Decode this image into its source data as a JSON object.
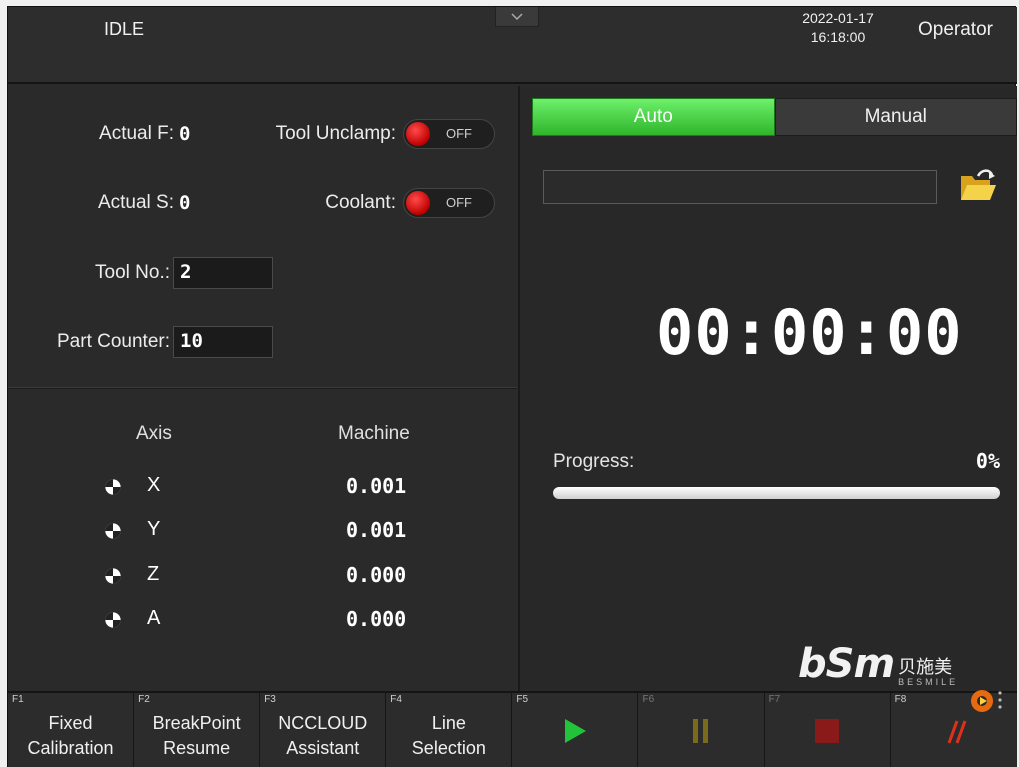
{
  "header": {
    "status": "IDLE",
    "date": "2022-01-17",
    "time": "16:18:00",
    "user": "Operator",
    "dropdown_icon": "chevron-down-icon"
  },
  "left": {
    "actual_f_label": "Actual F:",
    "actual_f_value": "0",
    "actual_s_label": "Actual S:",
    "actual_s_value": "0",
    "tool_unclamp_label": "Tool Unclamp:",
    "tool_unclamp_state": "OFF",
    "coolant_label": "Coolant:",
    "coolant_state": "OFF",
    "tool_no_label": "Tool No.:",
    "tool_no_value": "2",
    "part_counter_label": "Part Counter:",
    "part_counter_value": "10",
    "axis_header": "Axis",
    "machine_header": "Machine",
    "axes": [
      {
        "name": "X",
        "value": "0.001"
      },
      {
        "name": "Y",
        "value": "0.001"
      },
      {
        "name": "Z",
        "value": "0.000"
      },
      {
        "name": "A",
        "value": "0.000"
      }
    ]
  },
  "right": {
    "mode_auto": "Auto",
    "mode_manual": "Manual",
    "active_mode": "Auto",
    "file_path": "",
    "folder_icon": "folder-open-icon",
    "timer": "00:00:00",
    "progress_label": "Progress:",
    "progress_text": "0%",
    "progress_percent": 0,
    "logo_main": "bSm",
    "logo_cn": "贝施美",
    "logo_en": "BESMILE"
  },
  "fkeys": [
    {
      "key": "F1",
      "label1": "Fixed",
      "label2": "Calibration"
    },
    {
      "key": "F2",
      "label1": "BreakPoint",
      "label2": "Resume"
    },
    {
      "key": "F3",
      "label1": "NCCLOUD",
      "label2": "Assistant"
    },
    {
      "key": "F4",
      "label1": "Line",
      "label2": "Selection"
    },
    {
      "key": "F5",
      "icon": "play-icon"
    },
    {
      "key": "F6",
      "icon": "pause-icon"
    },
    {
      "key": "F7",
      "icon": "stop-icon"
    },
    {
      "key": "F8",
      "icon": "skip-lines-icon"
    }
  ],
  "colors": {
    "auto_green": "#3cd43a",
    "toggle_red": "#e01010",
    "play_green": "#22c33a",
    "pause_olive": "#7a6a1a",
    "stop_red": "#8a1a1a",
    "skip_red": "#e0301a"
  }
}
